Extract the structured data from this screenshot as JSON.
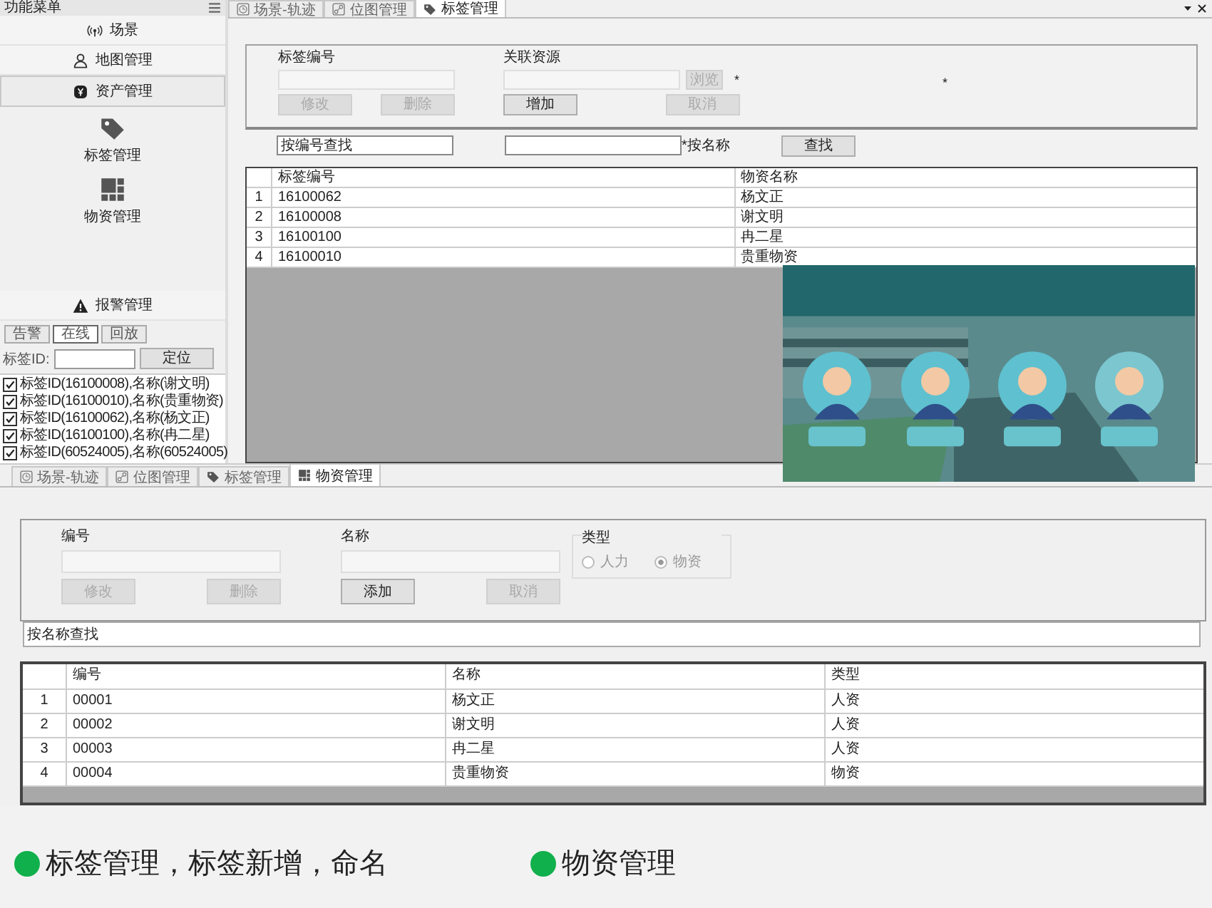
{
  "sidebar": {
    "title": "功能菜单",
    "menu": [
      {
        "label": "场景",
        "kind": "signal",
        "selected": false
      },
      {
        "label": "地图管理",
        "kind": "person",
        "selected": false
      },
      {
        "label": "资产管理",
        "kind": "coin",
        "selected": true
      }
    ],
    "sub_items": [
      {
        "label": "标签管理",
        "kind": "tag"
      },
      {
        "label": "物资管理",
        "kind": "grid"
      }
    ],
    "alarm": "报警管理",
    "tabs": [
      {
        "label": "告警",
        "selected": false
      },
      {
        "label": "在线",
        "selected": true
      },
      {
        "label": "回放",
        "selected": false
      }
    ],
    "tag_id_label": "标签ID:",
    "locate_button": "定位",
    "tags": [
      {
        "label": "标签ID(16100008),名称(谢文明)",
        "checked": true
      },
      {
        "label": "标签ID(16100010),名称(贵重物资)",
        "checked": true
      },
      {
        "label": "标签ID(16100062),名称(杨文正)",
        "checked": true
      },
      {
        "label": "标签ID(16100100),名称(冉二星)",
        "checked": true
      },
      {
        "label": "标签ID(60524005),名称(60524005)",
        "checked": true
      }
    ]
  },
  "top_tabs": [
    {
      "label": "场景-轨迹",
      "kind": "clock",
      "selected": false
    },
    {
      "label": "位图管理",
      "kind": "map",
      "selected": false
    },
    {
      "label": "标签管理",
      "kind": "tag",
      "selected": true
    }
  ],
  "tag_form": {
    "fields": [
      {
        "label": "标签编号"
      },
      {
        "label": "关联资源"
      }
    ],
    "browse_button": {
      "label": "浏览",
      "disabled": true
    },
    "buttons": [
      {
        "label": "修改",
        "disabled": true
      },
      {
        "label": "删除",
        "disabled": true
      },
      {
        "label": "增加",
        "disabled": false
      },
      {
        "label": "取消",
        "disabled": true
      }
    ],
    "marks": [
      "*",
      "*"
    ]
  },
  "tag_search": {
    "id_value": "按编号查找",
    "name_label": "*按名称",
    "button": "查找"
  },
  "tag_table": {
    "columns": [
      "标签编号",
      "物资名称"
    ],
    "rows": [
      {
        "index": "1",
        "cells": [
          "16100062",
          "杨文正"
        ]
      },
      {
        "index": "2",
        "cells": [
          "16100008",
          "谢文明"
        ]
      },
      {
        "index": "3",
        "cells": [
          "16100100",
          "冉二星"
        ]
      },
      {
        "index": "4",
        "cells": [
          "16100010",
          "贵重物资"
        ]
      }
    ]
  },
  "video": {
    "kind": "picture"
  },
  "bottom_tabs": [
    {
      "label": "场景-轨迹",
      "kind": "clock",
      "selected": false
    },
    {
      "label": "位图管理",
      "kind": "map",
      "selected": false
    },
    {
      "label": "标签管理",
      "kind": "tag",
      "selected": false
    },
    {
      "label": "物资管理",
      "kind": "grid",
      "selected": true
    }
  ],
  "goods_form": {
    "fields": [
      {
        "label": "编号"
      },
      {
        "label": "名称"
      }
    ],
    "buttons": [
      {
        "label": "修改",
        "disabled": true
      },
      {
        "label": "删除",
        "disabled": true
      },
      {
        "label": "添加",
        "disabled": false
      },
      {
        "label": "取消",
        "disabled": true
      }
    ],
    "type": {
      "label": "类型",
      "disabled": true,
      "options": [
        {
          "label": "人力",
          "selected": false
        },
        {
          "label": "物资",
          "selected": true
        }
      ]
    }
  },
  "goods_search": {
    "value": "按名称查找"
  },
  "goods_table": {
    "columns": [
      "编号",
      "名称",
      "类型"
    ],
    "rows": [
      {
        "index": "1",
        "cells": [
          "00001",
          "杨文正",
          "人资"
        ]
      },
      {
        "index": "2",
        "cells": [
          "00002",
          "谢文明",
          "人资"
        ]
      },
      {
        "index": "3",
        "cells": [
          "00003",
          "冉二星",
          "人资"
        ]
      },
      {
        "index": "4",
        "cells": [
          "00004",
          "贵重物资",
          "物资"
        ]
      }
    ]
  },
  "captions": [
    "标签管理，标签新增，命名",
    "物资管理"
  ]
}
